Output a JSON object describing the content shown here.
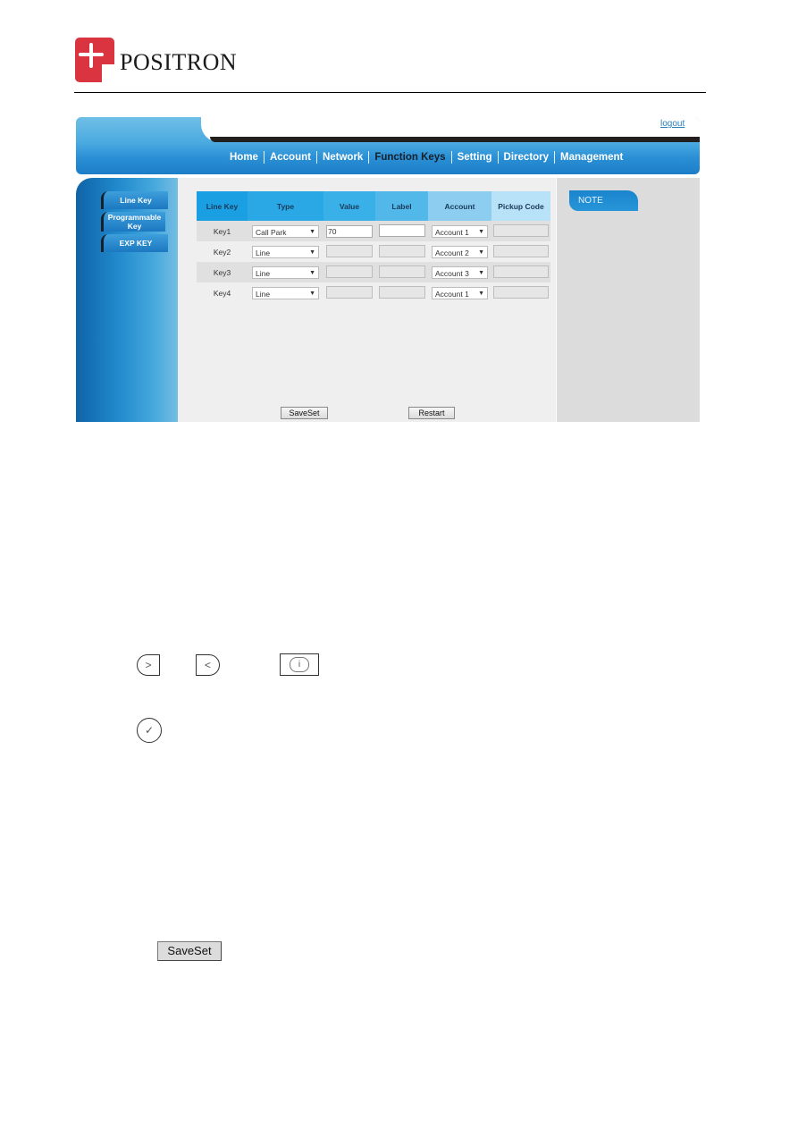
{
  "brand": {
    "name": "POSITRON",
    "color": "#d9343f"
  },
  "header": {
    "logout_label": "logout"
  },
  "nav": {
    "items": [
      "Home",
      "Account",
      "Network",
      "Function Keys",
      "Setting",
      "Directory",
      "Management"
    ],
    "active": "Function Keys"
  },
  "sidebar": {
    "items": [
      {
        "label": "Line Key"
      },
      {
        "label": "Programmable Key"
      },
      {
        "label": "EXP KEY"
      }
    ]
  },
  "table": {
    "headers": [
      "Line Key",
      "Type",
      "Value",
      "Label",
      "Account",
      "Pickup Code"
    ],
    "rows": [
      {
        "key": "Key1",
        "type": "Call Park",
        "value": "70",
        "label": "",
        "account": "Account 1",
        "pickup": ""
      },
      {
        "key": "Key2",
        "type": "Line",
        "value": "",
        "label": "",
        "account": "Account 2",
        "pickup": ""
      },
      {
        "key": "Key3",
        "type": "Line",
        "value": "",
        "label": "",
        "account": "Account 3",
        "pickup": ""
      },
      {
        "key": "Key4",
        "type": "Line",
        "value": "",
        "label": "",
        "account": "Account 1",
        "pickup": ""
      }
    ]
  },
  "buttons": {
    "saveset": "SaveSet",
    "restart": "Restart"
  },
  "note": {
    "title": "NOTE"
  },
  "manual": {
    "icons": [
      "right-arrow-key-icon",
      "left-arrow-key-icon",
      "info-key-icon",
      "ok-check-key-icon"
    ],
    "saveset_button": "SaveSet"
  }
}
